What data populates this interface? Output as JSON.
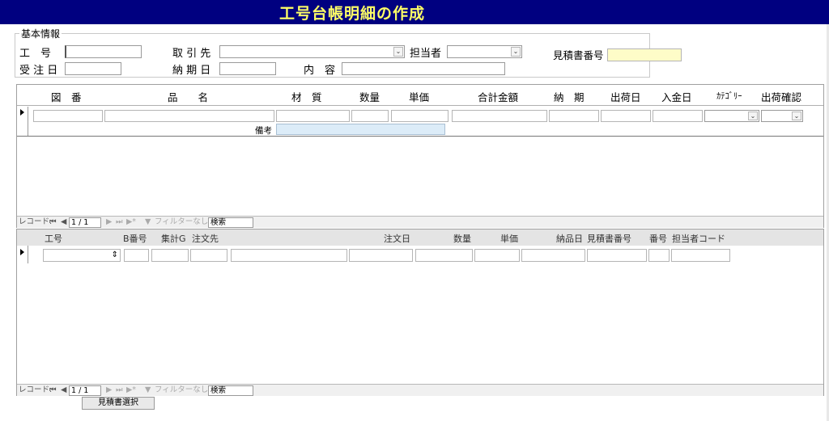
{
  "form": {
    "title": "工号台帳明細の作成"
  },
  "basic_info": {
    "group_label": "基本情報",
    "labels": {
      "kougo": "工　号",
      "torihikisaki": "取 引 先",
      "tantousha": "担当者",
      "mitsumori_no": "見積書番号",
      "juchu_date": "受 注 日",
      "nouki_date": "納 期 日",
      "naiyou": "内　容"
    },
    "values": {
      "kougo": "",
      "torihikisaki": "",
      "tantousha": "",
      "mitsumori_no": "",
      "juchu_date": "",
      "nouki_date": "",
      "naiyou": ""
    }
  },
  "detail_subform": {
    "columns": [
      "図　番",
      "品　　名",
      "材　質",
      "数量",
      "単価",
      "合計金額",
      "納　期",
      "出荷日",
      "入金日",
      "ｶﾃｺﾞﾘｰ",
      "出荷確認"
    ],
    "bikou_label": "備考",
    "nav": {
      "label": "レコード:",
      "position": "1 / 1",
      "filter": "フィルターなし",
      "search": "検索"
    }
  },
  "order_subform": {
    "columns": [
      "工号",
      "B番号",
      "集計G",
      "注文先",
      "注文日",
      "数量",
      "単価",
      "納品日",
      "見積書番号",
      "番号",
      "担当者コード"
    ],
    "nav": {
      "label": "レコード:",
      "position": "1 / 1",
      "filter": "フィルターなし",
      "search": "検索"
    }
  },
  "buttons": {
    "select_estimate": "見積書選択"
  },
  "colors": {
    "title_bg": "#000080",
    "title_text": "#ffff66",
    "highlight_field": "#fefcc8",
    "bikou_field": "#dcecf8"
  }
}
